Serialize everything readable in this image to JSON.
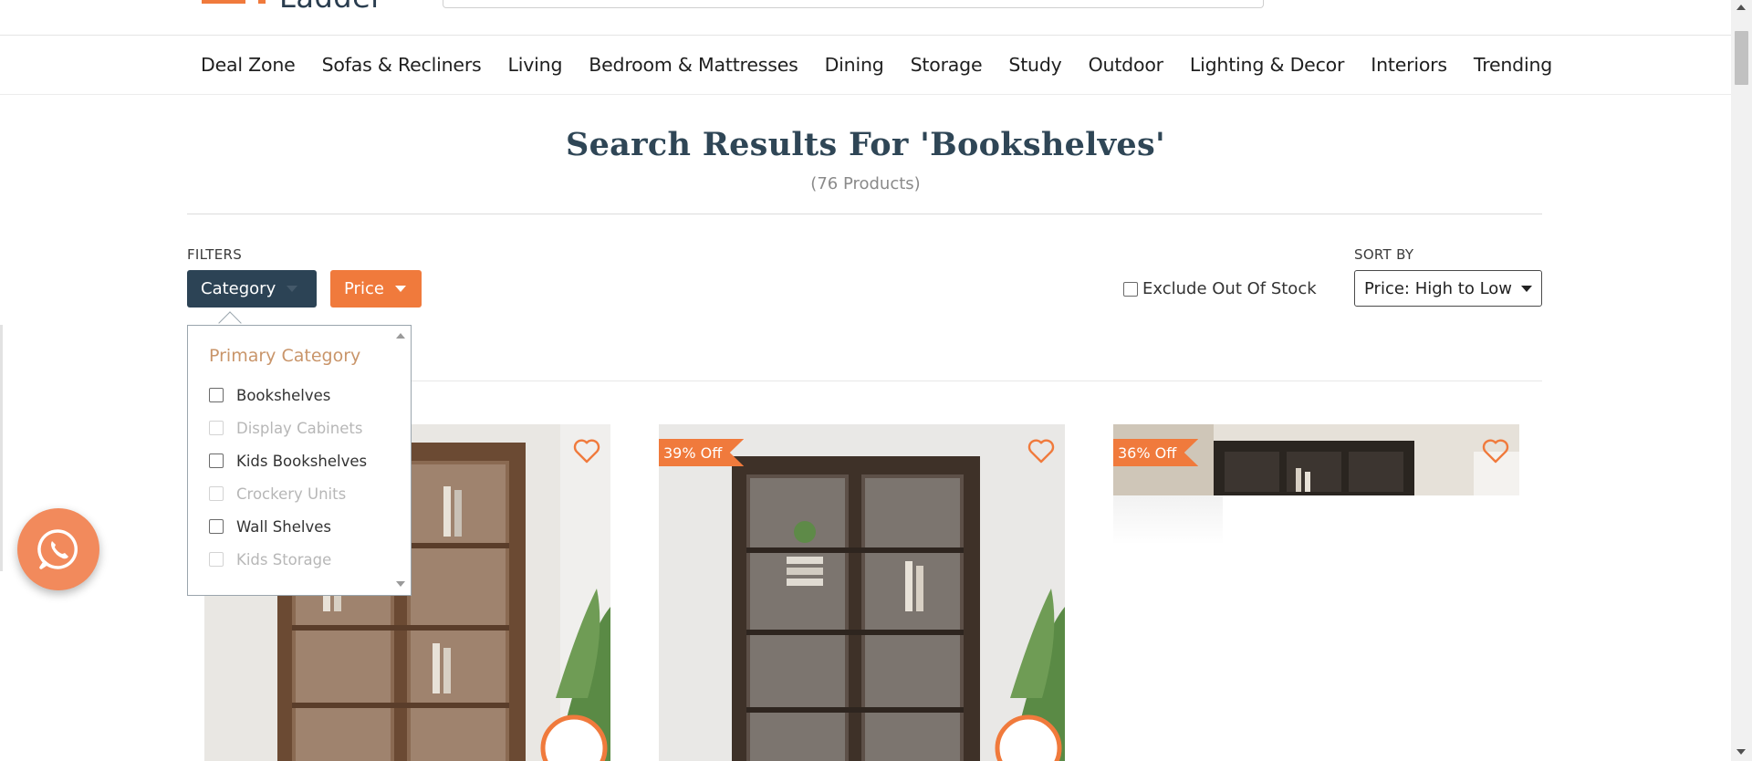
{
  "brand": {
    "logo_text": "Ladder",
    "accent_color": "#f07a3c",
    "dark_color": "#2c4355"
  },
  "nav": {
    "items": [
      "Deal Zone",
      "Sofas & Recliners",
      "Living",
      "Bedroom & Mattresses",
      "Dining",
      "Storage",
      "Study",
      "Outdoor",
      "Lighting & Decor",
      "Interiors",
      "Trending"
    ]
  },
  "results": {
    "title": "Search Results For 'Bookshelves'",
    "count": "(76 Products)"
  },
  "filters": {
    "label": "FILTERS",
    "category_label": "Category",
    "price_label": "Price",
    "exclude_oos_label": "Exclude Out Of Stock",
    "exclude_oos_checked": false
  },
  "sort": {
    "label": "SORT BY",
    "selected": "Price: High to Low"
  },
  "category_dropdown": {
    "section_title": "Primary Category",
    "options": [
      {
        "label": "Bookshelves",
        "enabled": true,
        "checked": false
      },
      {
        "label": "Display Cabinets",
        "enabled": false,
        "checked": false
      },
      {
        "label": "Kids Bookshelves",
        "enabled": true,
        "checked": false
      },
      {
        "label": "Crockery Units",
        "enabled": false,
        "checked": false
      },
      {
        "label": "Wall Shelves",
        "enabled": true,
        "checked": false
      },
      {
        "label": "Kids Storage",
        "enabled": false,
        "checked": false
      }
    ]
  },
  "products": [
    {
      "discount": "",
      "wishlisted": false
    },
    {
      "discount": "39% Off",
      "wishlisted": false
    },
    {
      "discount": "36% Off",
      "wishlisted": false
    }
  ],
  "icons": {
    "whatsapp": "whatsapp-icon",
    "heart": "heart-outline-icon"
  }
}
